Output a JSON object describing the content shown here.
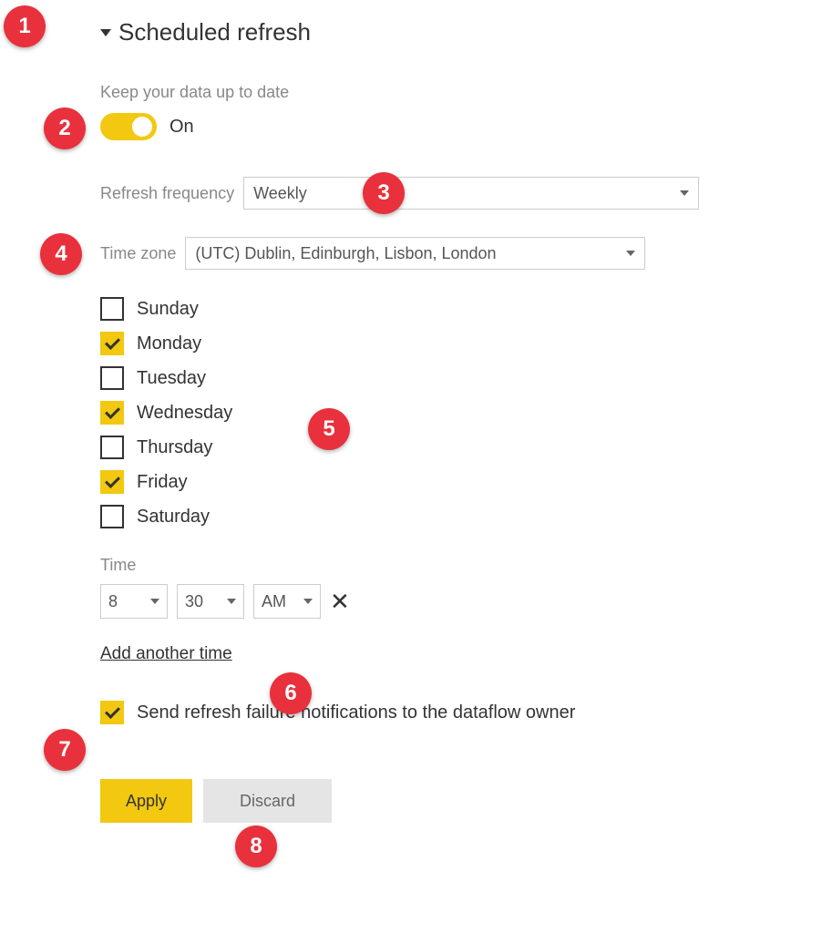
{
  "header": {
    "title": "Scheduled refresh"
  },
  "keepUpToDate": {
    "label": "Keep your data up to date",
    "state": "On"
  },
  "frequency": {
    "label": "Refresh frequency",
    "value": "Weekly"
  },
  "timezone": {
    "label": "Time zone",
    "value": "(UTC) Dublin, Edinburgh, Lisbon, London"
  },
  "days": [
    {
      "name": "Sunday",
      "checked": false
    },
    {
      "name": "Monday",
      "checked": true
    },
    {
      "name": "Tuesday",
      "checked": false
    },
    {
      "name": "Wednesday",
      "checked": true
    },
    {
      "name": "Thursday",
      "checked": false
    },
    {
      "name": "Friday",
      "checked": true
    },
    {
      "name": "Saturday",
      "checked": false
    }
  ],
  "time": {
    "label": "Time",
    "hour": "8",
    "minute": "30",
    "ampm": "AM"
  },
  "addTime": "Add another time",
  "notification": {
    "label": "Send refresh failure notifications to the dataflow owner",
    "checked": true
  },
  "buttons": {
    "apply": "Apply",
    "discard": "Discard"
  },
  "markers": {
    "m1": "1",
    "m2": "2",
    "m3": "3",
    "m4": "4",
    "m5": "5",
    "m6": "6",
    "m7": "7",
    "m8": "8"
  }
}
